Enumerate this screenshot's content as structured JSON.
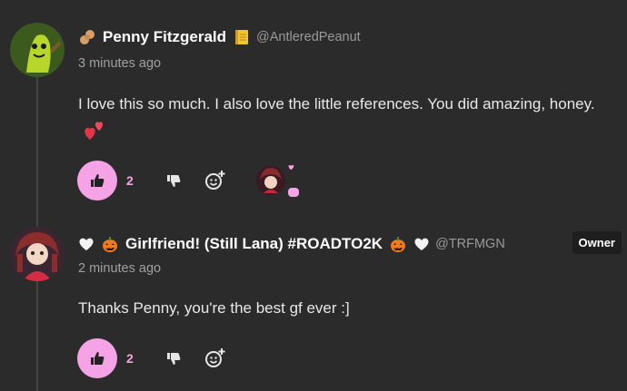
{
  "comments": [
    {
      "author_name": "Penny Fitzgerald",
      "author_handle": "@AntleredPeanut",
      "timestamp": "3 minutes ago",
      "text": "I love this so much. I also love the little references. You did amazing, honey.",
      "likes": "2",
      "prefix_emoji": "peanut-emoji",
      "suffix_emoji": "notebook-emoji",
      "inline_emoji": "two-hearts-emoji"
    },
    {
      "author_name": "Girlfriend! (Still Lana) #ROADTO2K",
      "author_handle": "@TRFMGN",
      "timestamp": "2 minutes ago",
      "text": "Thanks Penny, you're the best gf ever :]",
      "likes": "2",
      "badge": "Owner",
      "prefix_emoji": "white-heart-emoji",
      "pumpkin_emoji": "jack-o-lantern-emoji"
    }
  ],
  "colors": {
    "background": "#2b2b2b",
    "accent_pink": "#f5a3e6",
    "muted_text": "#9a9a9a"
  }
}
